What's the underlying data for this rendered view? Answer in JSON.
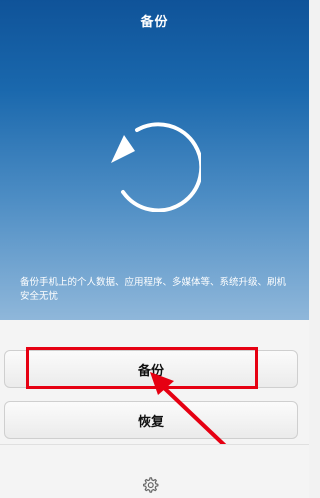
{
  "header": {
    "title": "备份"
  },
  "hero": {
    "icon": "backup-circular-arrow-icon",
    "description": "备份手机上的个人数据、应用程序、多媒体等、系统升级、刷机安全无忧"
  },
  "actions": {
    "backup_label": "备份",
    "restore_label": "恢复"
  },
  "footer": {
    "settings_icon": "gear-icon"
  },
  "annotation": {
    "highlight_color": "#e60012"
  }
}
